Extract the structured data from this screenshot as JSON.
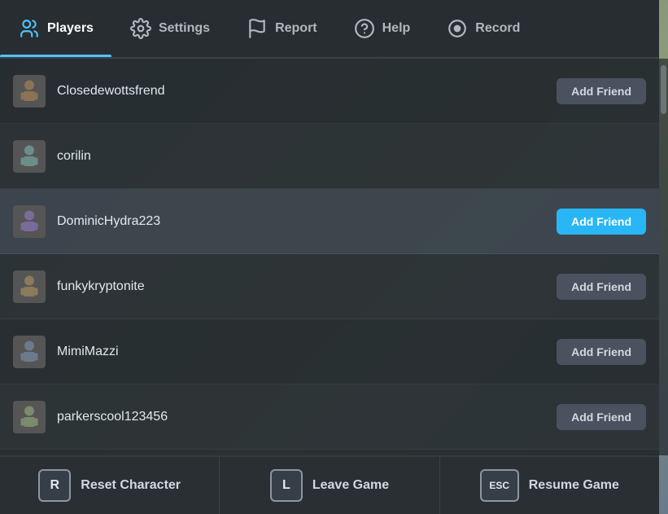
{
  "nav": {
    "items": [
      {
        "id": "players",
        "label": "Players",
        "active": true
      },
      {
        "id": "settings",
        "label": "Settings",
        "active": false
      },
      {
        "id": "report",
        "label": "Report",
        "active": false
      },
      {
        "id": "help",
        "label": "Help",
        "active": false
      },
      {
        "id": "record",
        "label": "Record",
        "active": false
      }
    ]
  },
  "players": [
    {
      "id": 1,
      "name": "Closedewottsfrend",
      "addFriendLabel": "Add Friend",
      "highlighted": false,
      "btnActive": false
    },
    {
      "id": 2,
      "name": "corilin",
      "addFriendLabel": "",
      "highlighted": false,
      "btnActive": false
    },
    {
      "id": 3,
      "name": "DominicHydra223",
      "addFriendLabel": "Add Friend",
      "highlighted": true,
      "btnActive": true
    },
    {
      "id": 4,
      "name": "funkykryptonite",
      "addFriendLabel": "Add Friend",
      "highlighted": false,
      "btnActive": false
    },
    {
      "id": 5,
      "name": "MimiMazzi",
      "addFriendLabel": "Add Friend",
      "highlighted": false,
      "btnActive": false
    },
    {
      "id": 6,
      "name": "parkerscool123456",
      "addFriendLabel": "Add Friend",
      "highlighted": false,
      "btnActive": false
    }
  ],
  "bottomBar": {
    "buttons": [
      {
        "key": "R",
        "label": "Reset Character"
      },
      {
        "key": "L",
        "label": "Leave Game"
      },
      {
        "key": "ESC",
        "label": "Resume Game"
      }
    ]
  },
  "colors": {
    "activeBtn": "#29b6f6",
    "normalBtn": "#4a5260"
  }
}
